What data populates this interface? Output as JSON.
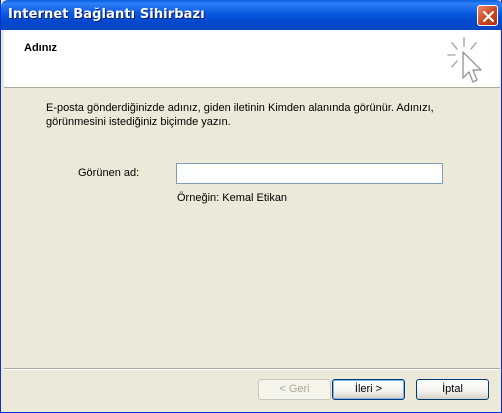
{
  "window": {
    "title": "Internet Bağlantı Sihirbazı"
  },
  "header": {
    "title": "Adınız",
    "icon": "wizard-cursor-icon"
  },
  "content": {
    "description": "E-posta gönderdiğinizde adınız, giden iletinin Kimden alanında görünür. Adınızı, görünmesini istediğiniz biçimde yazın.",
    "display_name_label": "Görünen ad:",
    "display_name_value": "",
    "example_text": "Örneğin: Kemal Etikan"
  },
  "buttons": {
    "back": "< Geri",
    "next": "İleri >",
    "cancel": "İptal"
  },
  "colors": {
    "titlebar": "#0a59e0",
    "dialog_bg": "#ece9d8",
    "close_button": "#c8451e"
  }
}
